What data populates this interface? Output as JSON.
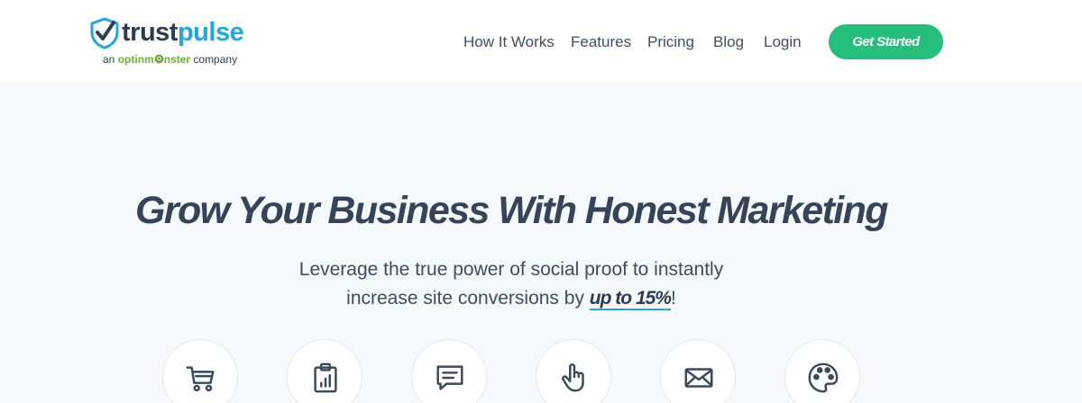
{
  "brand": {
    "name_part1": "trust",
    "name_part2": "pulse",
    "tagline_prefix": "an",
    "tagline_brand_a": "optinm",
    "tagline_brand_b": "nster",
    "tagline_suffix": "company",
    "shield_icon": "shield-check-icon",
    "colors": {
      "dark": "#2b3c53",
      "blue": "#1ea7e6",
      "green": "#6fb133"
    }
  },
  "nav": {
    "items": [
      {
        "label": "How It Works"
      },
      {
        "label": "Features"
      },
      {
        "label": "Pricing"
      },
      {
        "label": "Blog"
      },
      {
        "label": "Login"
      }
    ],
    "cta_label": "Get Started",
    "cta_color": "#25bf7c"
  },
  "hero": {
    "title": "Grow Your Business With Honest Marketing",
    "subtitle_line1": "Leverage the true power of social proof to instantly",
    "subtitle_line2_prefix": "increase site conversions by ",
    "subtitle_highlight": "up to 15%",
    "subtitle_line2_suffix": "!"
  },
  "features": {
    "icons": [
      "cart-icon",
      "clipboard-chart-icon",
      "message-icon",
      "pointer-hand-icon",
      "envelope-icon",
      "palette-icon"
    ]
  }
}
